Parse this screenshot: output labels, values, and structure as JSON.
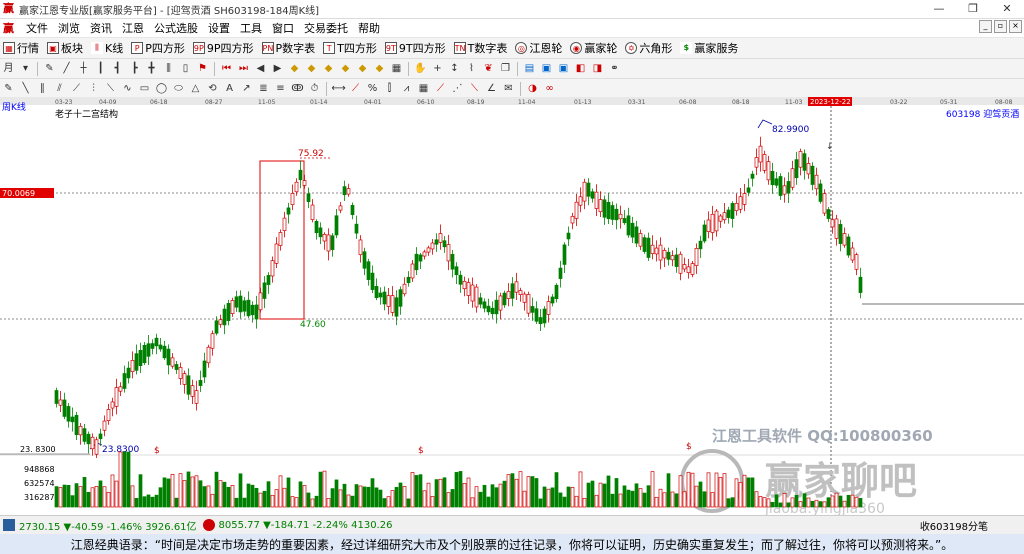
{
  "window": {
    "title": "赢家江恩专业版[赢家服务平台] - [迎驾贡酒  SH603198-184周K线]",
    "controls": [
      "—",
      "❐",
      "✕"
    ]
  },
  "menu": [
    "文件",
    "浏览",
    "资讯",
    "江恩",
    "公式选股",
    "设置",
    "工具",
    "窗口",
    "交易委托",
    "帮助"
  ],
  "toolbar": [
    {
      "label": "行情",
      "icon": "grid-icon"
    },
    {
      "label": "板块",
      "icon": "blocks-icon"
    },
    {
      "label": "K线",
      "icon": "kline-icon"
    },
    {
      "label": "P四方形",
      "icon": "p-square-icon"
    },
    {
      "label": "9P四方形",
      "icon": "9p-square-icon"
    },
    {
      "label": "P数字表",
      "icon": "p-table-icon"
    },
    {
      "label": "T四方形",
      "icon": "t-square-icon"
    },
    {
      "label": "9T四方形",
      "icon": "9t-square-icon"
    },
    {
      "label": "T数字表",
      "icon": "t-table-icon"
    },
    {
      "label": "江恩轮",
      "icon": "gann-wheel-icon"
    },
    {
      "label": "赢家轮",
      "icon": "winner-wheel-icon"
    },
    {
      "label": "六角形",
      "icon": "hexagon-icon"
    },
    {
      "label": "赢家服务",
      "icon": "dollar-icon"
    }
  ],
  "chart": {
    "period_label": "周K线",
    "indicator_title": "老子十二宫结构",
    "stock_label": "603198 迎驾贡酒",
    "current_date_tag": "2023-12-22",
    "date_ticks": [
      "03-23",
      "04-09",
      "06-18",
      "08-27",
      "11-05",
      "01-14",
      "04-01",
      "06-10",
      "08-19",
      "11-04",
      "01-13",
      "03-31",
      "06-08",
      "08-18",
      "11-03",
      "2023-12-22",
      "03-22",
      "05-31",
      "08-08"
    ],
    "price_tag": "70.0069",
    "high_label": "82.9900",
    "low_label": "23.8300",
    "left_axis_low": "23. 8300",
    "box_top_label": "75.92",
    "box_bottom_label": "47.60",
    "volume_ticks": [
      "948868",
      "632574",
      "316287"
    ],
    "dollar_markers": [
      "$",
      "$",
      "$"
    ],
    "watermark_line": "江恩工具软件  QQ:100800360",
    "watermark_brand": "赢家聊吧",
    "watermark_url": "jiaoba.yingjia360",
    "colors": {
      "up": "#d00000",
      "down": "#008000",
      "highlight": "#ff0000"
    }
  },
  "status": {
    "index1": "2730.15 ▼-40.59 -1.46% 3926.61亿",
    "index2": "8055.77 ▼-184.71 -2.24% 4130.26",
    "right": "收603198分笔"
  },
  "quote": "江恩经典语录：“时间是决定市场走势的重要因素，经过详细研究大市及个别股票的过往记录，你将可以证明，历史确实重复发生；而了解过往，你将可以预测将来。”。"
}
